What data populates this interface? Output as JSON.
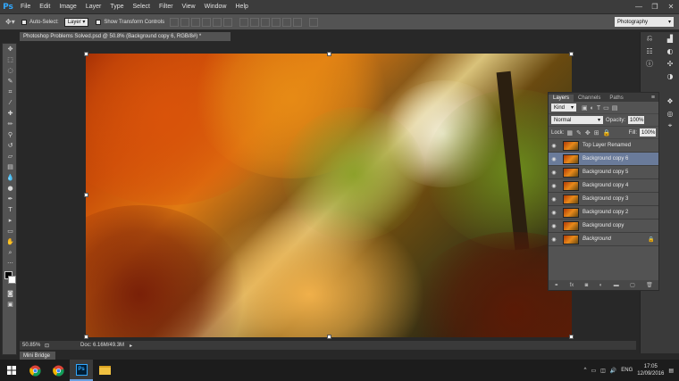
{
  "app": {
    "logo": "Ps"
  },
  "menu": [
    "File",
    "Edit",
    "Image",
    "Layer",
    "Type",
    "Select",
    "Filter",
    "View",
    "Window",
    "Help"
  ],
  "window_controls": {
    "minimize": "—",
    "restore": "❐",
    "close": "✕"
  },
  "options": {
    "auto_select_label": "Auto-Select:",
    "auto_select_value": "Layer",
    "show_transform_label": "Show Transform Controls",
    "workspace": "Photography"
  },
  "document": {
    "tab_title": "Photoshop Problems Solved.psd @ 50.8% (Background copy 6, RGB/8#) *",
    "zoom": "50.85%",
    "doc_info": "Doc: 6.16M/49.3M"
  },
  "layers_panel": {
    "tabs": [
      "Layers",
      "Channels",
      "Paths"
    ],
    "filter_kind": "Kind",
    "blend_mode": "Normal",
    "opacity_label": "Opacity:",
    "opacity": "100%",
    "lock_label": "Lock:",
    "fill_label": "Fill:",
    "fill": "100%",
    "layers": [
      {
        "name": "Top Layer Renamed"
      },
      {
        "name": "Background copy 6"
      },
      {
        "name": "Background copy 5"
      },
      {
        "name": "Background copy 4"
      },
      {
        "name": "Background copy 3"
      },
      {
        "name": "Background copy 2"
      },
      {
        "name": "Background copy"
      },
      {
        "name": "Background"
      }
    ]
  },
  "mini_bridge": "Mini Bridge",
  "taskbar": {
    "language": "ENG",
    "time": "17:05",
    "date": "12/09/2016"
  },
  "colors": {
    "accent": "#31a8ff",
    "selected_layer": "#6a7b9a",
    "panel_bg": "#535353"
  }
}
